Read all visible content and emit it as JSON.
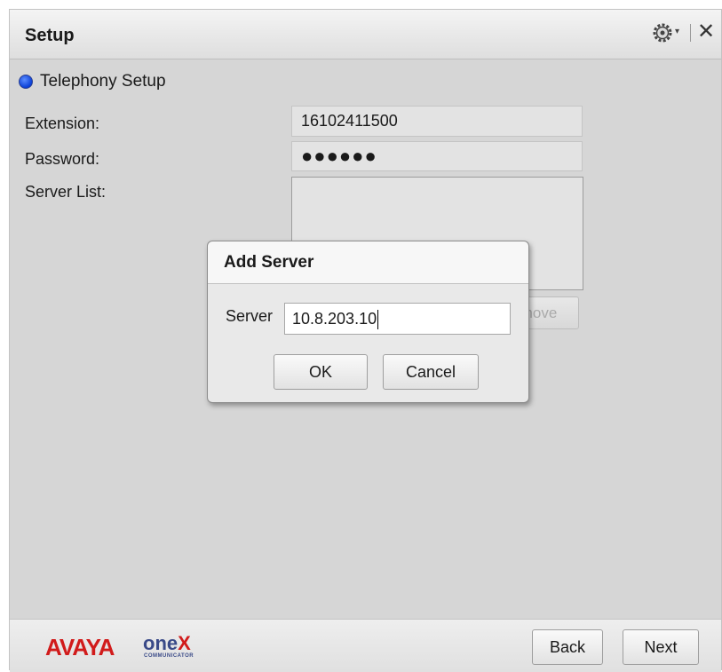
{
  "window": {
    "title": "Setup"
  },
  "titlebar": {
    "caret": "▾",
    "close": "✕"
  },
  "setup": {
    "section_label": "Telephony Setup",
    "extension_label": "Extension:",
    "extension_value": "16102411500",
    "password_label": "Password:",
    "password_mask": "●●●●●●",
    "server_list_label": "Server List:",
    "remove_button_label": "Remove"
  },
  "dialog": {
    "title": "Add Server",
    "server_label": "Server",
    "server_value": "10.8.203.10",
    "ok_label": "OK",
    "cancel_label": "Cancel"
  },
  "footer": {
    "logo_brand": "AVAYA",
    "logo_product": "one",
    "logo_product_x": "X",
    "logo_sub": "COMMUNICATOR",
    "back_label": "Back",
    "next_label": "Next"
  },
  "colors": {
    "accent_red": "#d11b1b",
    "radio_blue": "#0a3fd6",
    "logo_navy": "#3a4a88"
  },
  "icons": [
    "gear-icon",
    "chevron-down-icon",
    "close-icon",
    "radio-selected-icon"
  ]
}
